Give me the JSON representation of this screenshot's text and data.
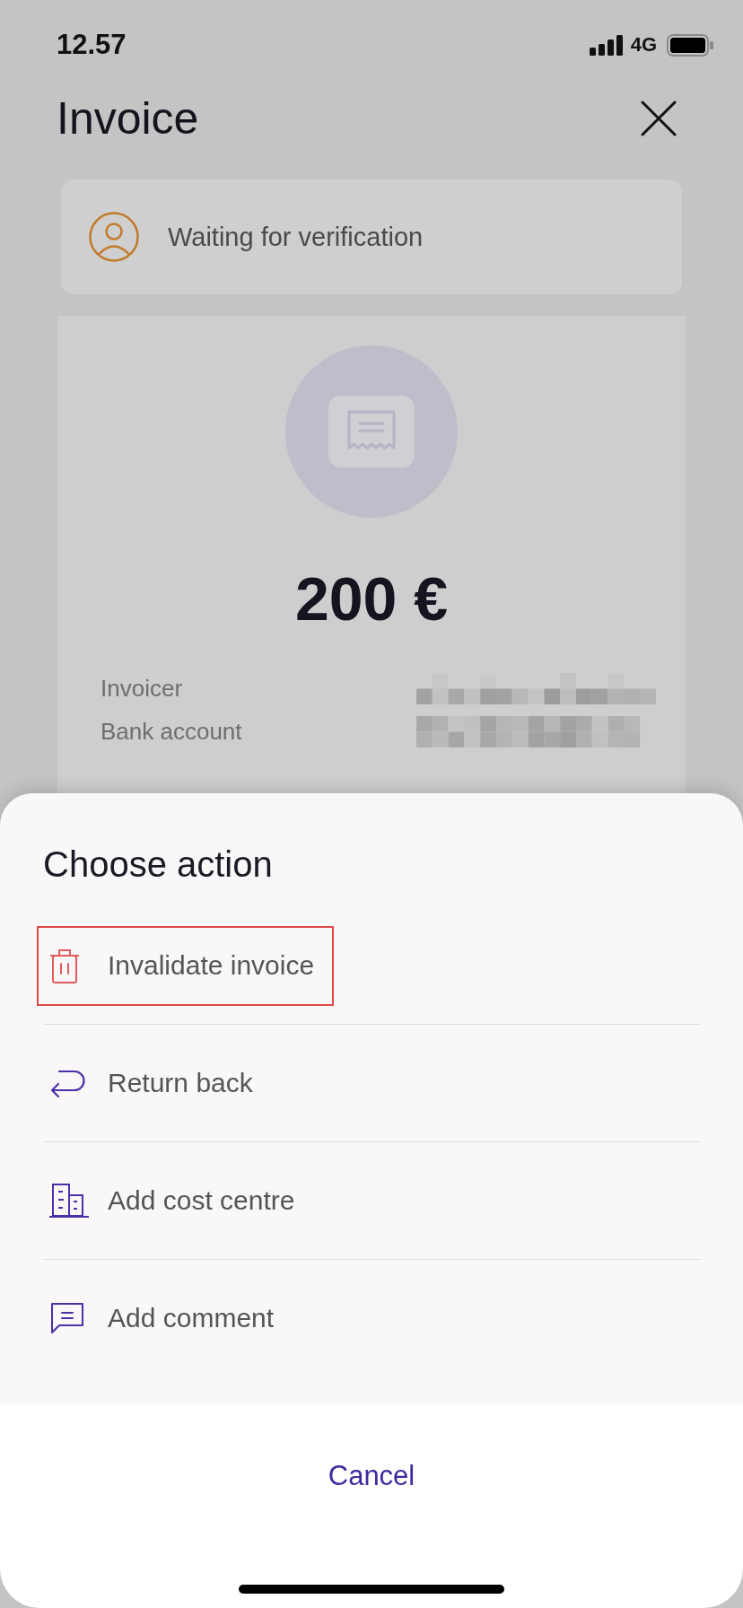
{
  "status_bar": {
    "time": "12.57",
    "network": "4G"
  },
  "header": {
    "title": "Invoice"
  },
  "status_card": {
    "text": "Waiting for verification"
  },
  "invoice_card": {
    "amount": "200 €",
    "fields": [
      {
        "label": "Invoicer",
        "value_redacted": true
      },
      {
        "label": "Bank account",
        "value_redacted": true
      }
    ]
  },
  "action_sheet": {
    "title": "Choose action",
    "actions": [
      {
        "kind": "invalidate",
        "label": "Invalidate invoice",
        "highlighted": true
      },
      {
        "kind": "return",
        "label": "Return back",
        "highlighted": false
      },
      {
        "kind": "cost_centre",
        "label": "Add cost centre",
        "highlighted": false
      },
      {
        "kind": "comment",
        "label": "Add comment",
        "highlighted": false
      }
    ],
    "cancel": "Cancel"
  }
}
